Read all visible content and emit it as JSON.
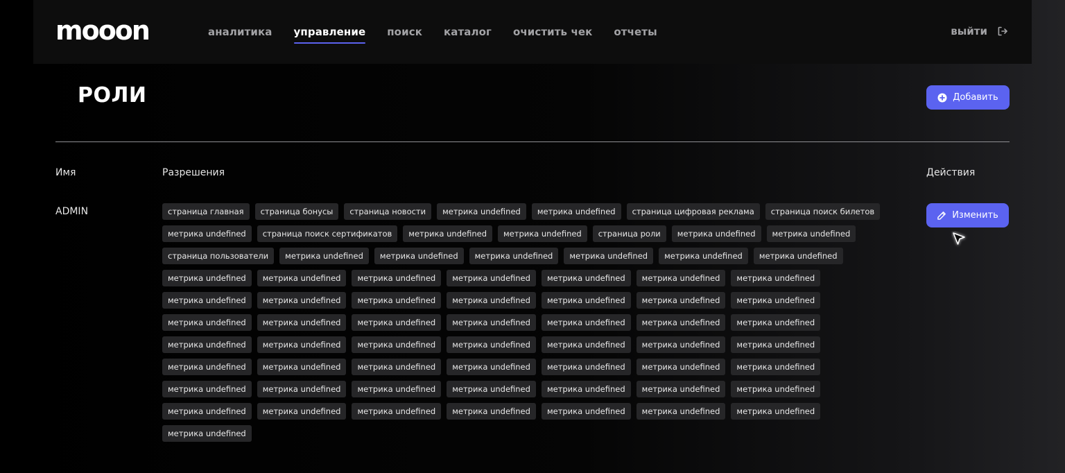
{
  "header": {
    "logo_text": "mooon",
    "nav": [
      {
        "label": "аналитика",
        "active": false
      },
      {
        "label": "управление",
        "active": true
      },
      {
        "label": "поиск",
        "active": false
      },
      {
        "label": "каталог",
        "active": false
      },
      {
        "label": "очистить чек",
        "active": false
      },
      {
        "label": "отчеты",
        "active": false
      }
    ],
    "logout_label": "выйти",
    "logout_icon": "logout-icon"
  },
  "page": {
    "title": "РОЛИ",
    "add_button_label": "Добавить",
    "add_icon": "plus-circle-icon"
  },
  "table": {
    "columns": {
      "name": "Имя",
      "permissions": "Разрешения",
      "actions": "Действия"
    },
    "rows": [
      {
        "name": "ADMIN",
        "edit_label": "Изменить",
        "edit_icon": "pencil-icon",
        "permissions": [
          "страница главная",
          "страница бонусы",
          "страница новости",
          "метрика undefined",
          "метрика undefined",
          "страница цифровая реклама",
          "страница поиск билетов",
          "метрика undefined",
          "страница поиск сертификатов",
          "метрика undefined",
          "метрика undefined",
          "страница роли",
          "метрика undefined",
          "метрика undefined",
          "страница пользователи",
          "метрика undefined",
          "метрика undefined",
          "метрика undefined",
          "метрика undefined",
          "метрика undefined",
          "метрика undefined",
          "метрика undefined",
          "метрика undefined",
          "метрика undefined",
          "метрика undefined",
          "метрика undefined",
          "метрика undefined",
          "метрика undefined",
          "метрика undefined",
          "метрика undefined",
          "метрика undefined",
          "метрика undefined",
          "метрика undefined",
          "метрика undefined",
          "метрика undefined",
          "метрика undefined",
          "метрика undefined",
          "метрика undefined",
          "метрика undefined",
          "метрика undefined",
          "метрика undefined",
          "метрика undefined",
          "метрика undefined",
          "метрика undefined",
          "метрика undefined",
          "метрика undefined",
          "метрика undefined",
          "метрика undefined",
          "метрика undefined",
          "метрика undefined",
          "метрика undefined",
          "метрика undefined",
          "метрика undefined",
          "метрика undefined",
          "метрика undefined",
          "метрика undefined",
          "метрика undefined",
          "метрика undefined",
          "метрика undefined",
          "метрика undefined",
          "метрика undefined",
          "метрика undefined",
          "метрика undefined",
          "метрика undefined",
          "метрика undefined",
          "метрика undefined",
          "метрика undefined",
          "метрика undefined",
          "метрика undefined",
          "метрика undefined",
          "метрика undefined"
        ]
      }
    ]
  },
  "colors": {
    "accent": "#5b63f0",
    "tag_bg": "#262628",
    "header_bg": "#0d0d0d",
    "nav_inactive": "#a3a3a6"
  }
}
